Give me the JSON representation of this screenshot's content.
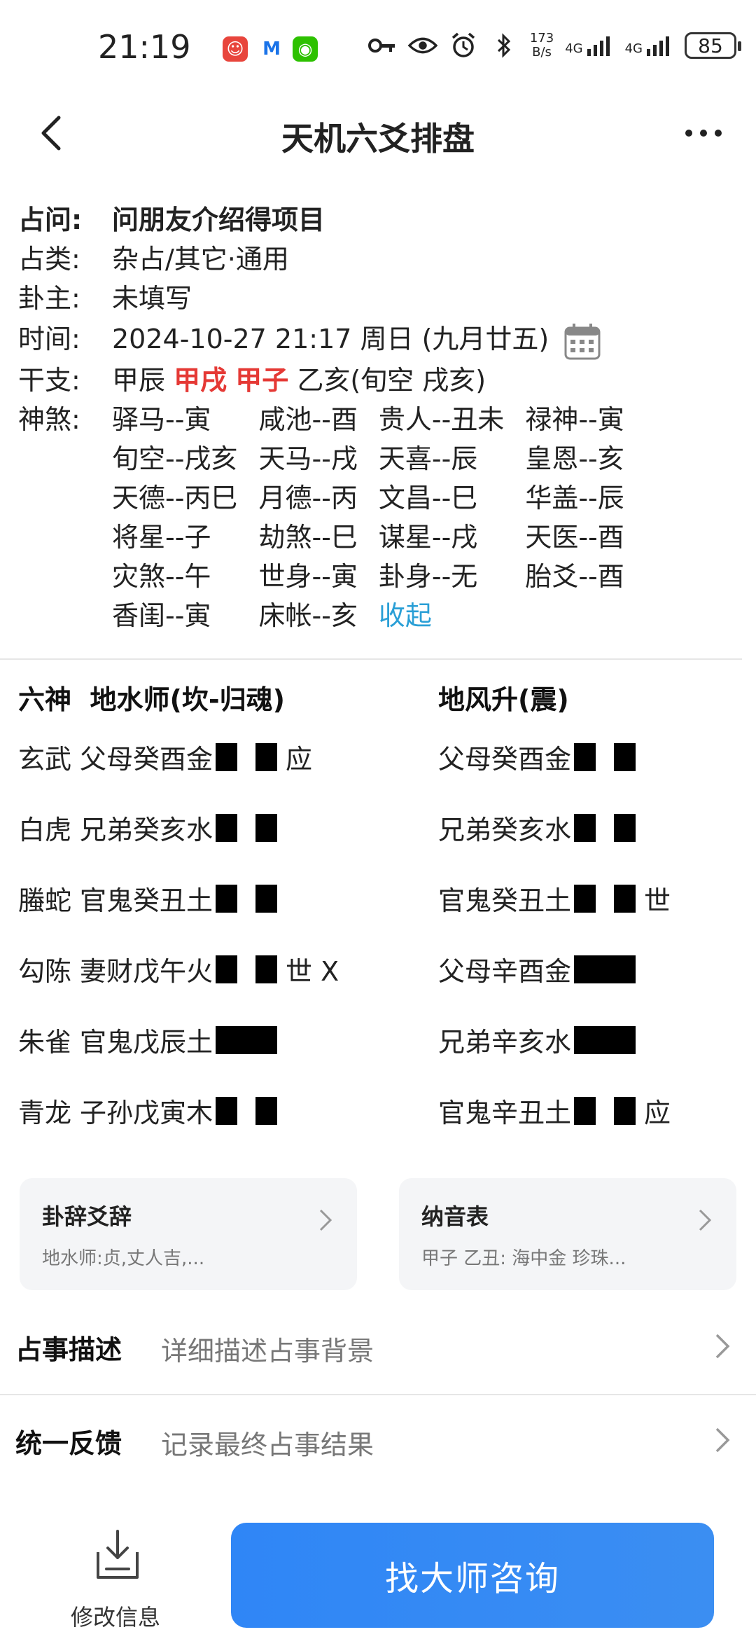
{
  "status_bar": {
    "time": "21:19",
    "speed": "173",
    "speed_unit": "B/s",
    "net1": "4G",
    "net2": "4G",
    "battery": "85"
  },
  "nav": {
    "title": "天机六爻排盘"
  },
  "info": {
    "q_label": "占问:",
    "q_value": "问朋友介绍得项目",
    "type_label": "占类:",
    "type_value": "杂占/其它·通用",
    "owner_label": "卦主:",
    "owner_value": "未填写",
    "time_label": "时间:",
    "time_value": "2024-10-27 21:17 周日 (九月廿五)",
    "gz_label": "干支:",
    "gz_year": "甲辰",
    "gz_month": "甲戌",
    "gz_day": "甲子",
    "gz_hour": "乙亥(旬空 戌亥)",
    "shensha_label": "神煞:",
    "shensha": [
      "驿马--寅",
      "咸池--酉",
      "贵人--丑未",
      "禄神--寅",
      "旬空--戌亥",
      "天马--戌",
      "天喜--辰",
      "皇恩--亥",
      "天德--丙巳",
      "月德--丙",
      "文昌--巳",
      "华盖--辰",
      "将星--子",
      "劫煞--巳",
      "谋星--戌",
      "天医--酉",
      "灾煞--午",
      "世身--寅",
      "卦身--无",
      "胎爻--酉",
      "香闺--寅",
      "床帐--亥"
    ],
    "collapse": "收起"
  },
  "hexagram": {
    "left_header": "六神  地水师(坎-归魂)",
    "right_header": "地风升(震)",
    "rows": [
      {
        "god": "玄武",
        "left": "父母癸酉金",
        "left_yang": false,
        "left_mark": "应",
        "right": "父母癸酉金",
        "right_yang": false,
        "right_mark": ""
      },
      {
        "god": "白虎",
        "left": "兄弟癸亥水",
        "left_yang": false,
        "left_mark": "",
        "right": "兄弟癸亥水",
        "right_yang": false,
        "right_mark": ""
      },
      {
        "god": "螣蛇",
        "left": "官鬼癸丑土",
        "left_yang": false,
        "left_mark": "",
        "right": "官鬼癸丑土",
        "right_yang": false,
        "right_mark": "世"
      },
      {
        "god": "勾陈",
        "left": "妻财戊午火",
        "left_yang": false,
        "left_mark": "世 X",
        "right": "父母辛酉金",
        "right_yang": true,
        "right_mark": ""
      },
      {
        "god": "朱雀",
        "left": "官鬼戊辰土",
        "left_yang": true,
        "left_mark": "",
        "right": "兄弟辛亥水",
        "right_yang": true,
        "right_mark": ""
      },
      {
        "god": "青龙",
        "left": "子孙戊寅木",
        "left_yang": false,
        "left_mark": "",
        "right": "官鬼辛丑土",
        "right_yang": false,
        "right_mark": "应"
      }
    ]
  },
  "cards": {
    "c1_title": "卦辞爻辞",
    "c1_sub": "地水师:贞,丈人吉,...",
    "c2_title": "纳音表",
    "c2_sub": "甲子 乙丑: 海中金 珍珠..."
  },
  "list": {
    "desc_label": "占事描述",
    "desc_value": "详细描述占事背景",
    "feedback_label": "统一反馈",
    "feedback_value": "记录最终占事结果"
  },
  "bottom": {
    "edit_label": "修改信息",
    "cta_label": "找大师咨询"
  },
  "colors": {
    "accent": "#2f86f6",
    "highlight_red": "#e53935",
    "link": "#2a9fd6"
  }
}
